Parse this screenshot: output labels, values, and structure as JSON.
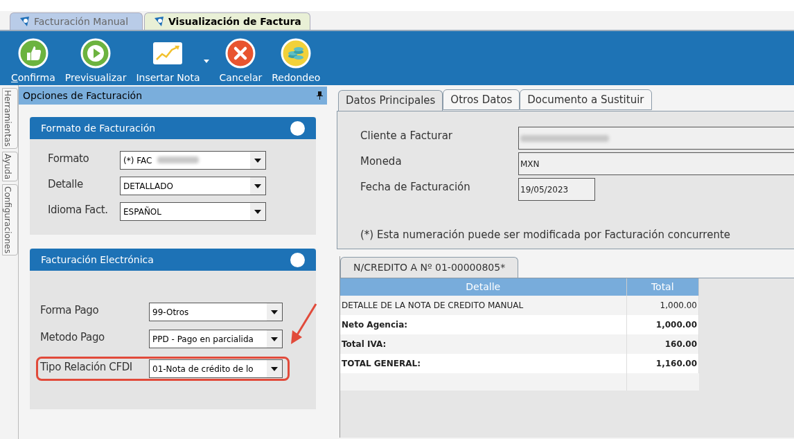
{
  "document_tabs": [
    {
      "label": "Facturación Manual",
      "selected": false
    },
    {
      "label": "Visualización de Factura",
      "selected": true
    }
  ],
  "toolbar": [
    {
      "label": "Confirma",
      "mnemonic_underlined": true,
      "has_menu": false
    },
    {
      "label": "Previsualizar",
      "mnemonic_underlined": false,
      "has_menu": false
    },
    {
      "label": "Insertar Nota",
      "mnemonic_underlined": false,
      "has_menu": true
    },
    {
      "label": "Cancelar",
      "mnemonic_underlined": false,
      "has_menu": false
    },
    {
      "label": "Redondeo",
      "mnemonic_underlined": false,
      "has_menu": false
    }
  ],
  "side_tabs": [
    "Herramientas",
    "Ayuda",
    "Configuraciones"
  ],
  "options_panel": {
    "title": "Opciones de Facturación",
    "groups": [
      {
        "title": "Formato de Facturación",
        "fields": [
          {
            "label": "Formato",
            "value": "(*) FAC",
            "redacted": true,
            "highlighted": false
          },
          {
            "label": "Detalle",
            "value": "DETALLADO",
            "redacted": false,
            "highlighted": false
          },
          {
            "label": "Idioma Fact.",
            "value": "ESPAÑOL",
            "redacted": false,
            "highlighted": false
          }
        ]
      },
      {
        "title": "Facturación Electrónica",
        "fields": [
          {
            "label": "Forma Pago",
            "value": "99-Otros",
            "redacted": false,
            "highlighted": false
          },
          {
            "label": "Metodo Pago",
            "value": "PPD - Pago en parcialida",
            "redacted": false,
            "highlighted": false
          },
          {
            "label": "Tipo Relación CFDI",
            "value": "01-Nota de crédito de lo",
            "redacted": false,
            "highlighted": true
          }
        ]
      }
    ]
  },
  "detail_tabs": [
    {
      "label": "Datos Principales",
      "selected": true
    },
    {
      "label": "Otros Datos",
      "selected": false
    },
    {
      "label": "Documento a Sustituir",
      "selected": false
    }
  ],
  "main_fields": [
    {
      "label": "Cliente a Facturar",
      "redacted": true,
      "kind": "wide"
    },
    {
      "label": "Moneda",
      "value": "MXN",
      "redacted": false,
      "kind": "wide"
    },
    {
      "label": "Fecha de Facturación",
      "value": "19/05/2023",
      "redacted": false,
      "kind": "short"
    }
  ],
  "note": "(*) Esta numeración puede ser modificada por Facturación concurrente",
  "note_tab": {
    "label": "N/CREDITO A Nº 01-00000805*"
  },
  "table": {
    "columns": [
      "Detalle",
      "Total"
    ],
    "rows": [
      {
        "cells": [
          "DETALLE DE LA NOTA DE CREDITO MANUAL",
          "1,000.00"
        ],
        "bold": false
      },
      {
        "cells": [
          "Neto Agencia:",
          "1,000.00"
        ],
        "bold": true
      },
      {
        "cells": [
          "Total IVA:",
          "160.00"
        ],
        "bold": true
      },
      {
        "cells": [
          "TOTAL GENERAL:",
          "1,160.00"
        ],
        "bold": true
      }
    ]
  }
}
